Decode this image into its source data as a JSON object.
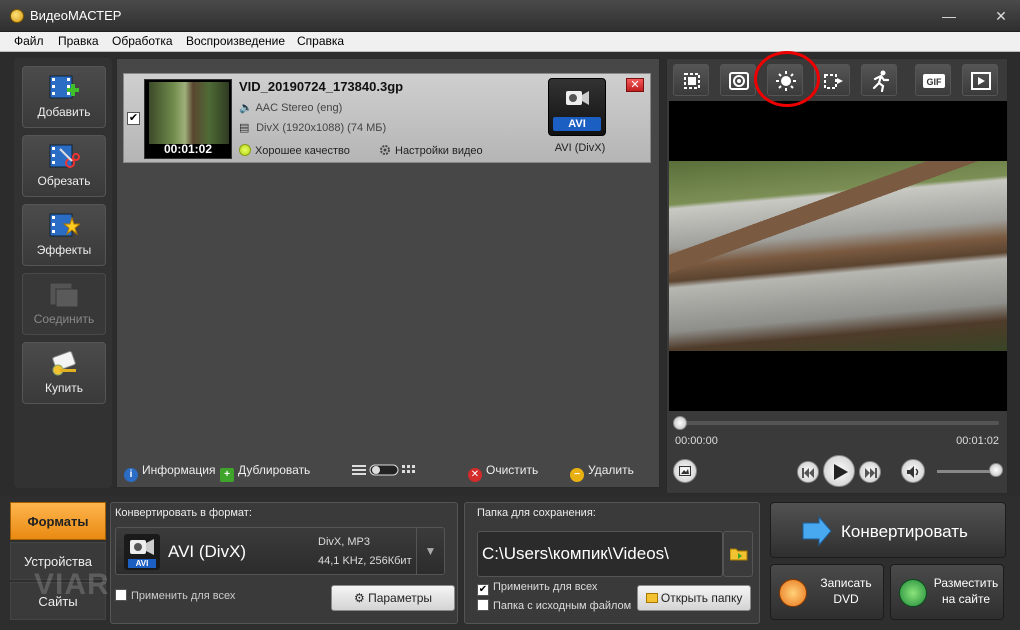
{
  "window": {
    "title": "ВидеоМАСТЕР",
    "minimize": "—",
    "close": "✕"
  },
  "menu": [
    "Файл",
    "Правка",
    "Обработка",
    "Воспроизведение",
    "Справка"
  ],
  "left_tools": [
    {
      "label": "Добавить",
      "icon": "film-plus-icon",
      "enabled": true
    },
    {
      "label": "Обрезать",
      "icon": "film-scissors-icon",
      "enabled": true
    },
    {
      "label": "Эффекты",
      "icon": "film-star-icon",
      "enabled": true
    },
    {
      "label": "Соединить",
      "icon": "film-join-icon",
      "enabled": false
    },
    {
      "label": "Купить",
      "icon": "key-tag-icon",
      "enabled": true
    }
  ],
  "file": {
    "checked": true,
    "name": "VID_20190724_173840.3gp",
    "duration": "00:01:02",
    "audio": "AAC Stereo (eng)",
    "video": "DivX (1920x1088) (74 МБ)",
    "quality": "Хорошее качество",
    "settings": "Настройки видео",
    "format_tag": "AVI",
    "format_label": "AVI (DivX)"
  },
  "list_toolbar": {
    "info": "Информация",
    "duplicate": "Дублировать",
    "clear": "Очистить",
    "delete": "Удалить"
  },
  "player": {
    "time_start": "00:00:00",
    "time_end": "00:01:02",
    "position": 0,
    "volume": 1.0,
    "fx_buttons": [
      "crop-icon",
      "stabilize-icon",
      "brightness-icon",
      "rotate-icon",
      "speed-runner-icon",
      "gif-icon",
      "screen-icon"
    ],
    "gif_label": "GIF",
    "highlighted": "brightness-icon"
  },
  "bottom_tabs": [
    {
      "label": "Форматы",
      "active": true
    },
    {
      "label": "Устройства",
      "active": false
    },
    {
      "label": "Сайты",
      "active": false
    }
  ],
  "watermark": "VIARUM",
  "convert": {
    "label": "Конвертировать в формат:",
    "format_name": "AVI (DivX)",
    "format_tag": "AVI",
    "spec1": "DivX, MP3",
    "spec2": "44,1 KHz, 256Кбит",
    "apply_all": "Применить для всех",
    "params": "Параметры"
  },
  "save": {
    "label": "Папка для сохранения:",
    "path": "C:\\Users\\компик\\Videos\\",
    "apply_all": "Применить для всех",
    "apply_all_checked": true,
    "source_folder": "Папка с исходным файлом",
    "source_folder_checked": false,
    "open_folder": "Открыть папку"
  },
  "actions": {
    "convert": "Конвертировать",
    "dvd": "Записать DVD",
    "web": "Разместить на сайте"
  },
  "colors": {
    "accent_orange": "#f0a030",
    "highlight_red": "#e00000",
    "avi_blue": "#1c5fc2"
  }
}
